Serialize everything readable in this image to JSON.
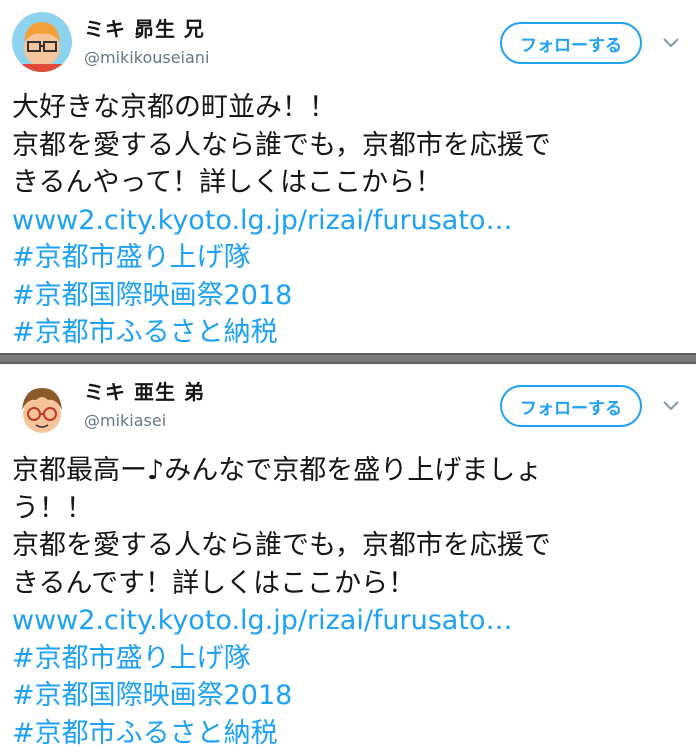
{
  "tweets": [
    {
      "name": "ミキ 昴生 兄",
      "handle": "@mikikouseiani",
      "follow_label": "フォローする",
      "text_lines": [
        "大好きな京都の町並み！！",
        "京都を愛する人なら誰でも，京都市を応援で",
        "きるんやって！詳しくはここから！"
      ],
      "link": "www2.city.kyoto.lg.jp/rizai/furusato…",
      "hashtags": [
        "#京都市盛り上げ隊",
        "#京都国際映画祭2018",
        "#京都市ふるさと納税"
      ]
    },
    {
      "name": "ミキ 亜生 弟",
      "handle": "@mikiasei",
      "follow_label": "フォローする",
      "text_lines": [
        "京都最高ー♪みんなで京都を盛り上げましょ",
        "う！！",
        "京都を愛する人なら誰でも，京都市を応援で",
        "きるんです！詳しくはここから！"
      ],
      "link": "www2.city.kyoto.lg.jp/rizai/furusato…",
      "hashtags": [
        "#京都市盛り上げ隊",
        "#京都国際映画祭2018",
        "#京都市ふるさと納税"
      ]
    }
  ],
  "colors": {
    "accent": "#1da1f2",
    "text": "#14171a",
    "muted": "#657786",
    "divider": "#7a7a7a"
  },
  "icons": {
    "menu": "chevron-down-icon"
  }
}
